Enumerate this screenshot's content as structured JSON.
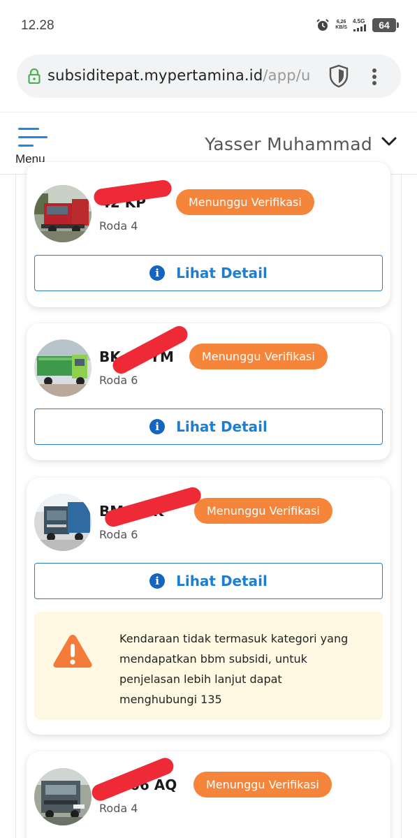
{
  "status_bar": {
    "time": "12.28",
    "net_speed_value": "6,26",
    "net_speed_unit": "KB/S",
    "network_type": "4.5G",
    "battery_level": "64"
  },
  "browser": {
    "url_host": "subsiditepat.mypertamina.id",
    "url_path": "/app/u"
  },
  "header": {
    "menu_label": "Menu",
    "user_name": "Yasser Muhammad"
  },
  "vehicles": [
    {
      "plate_visible": "42 KP",
      "status": "Menunggu Verifikasi",
      "wheels": "Roda 4",
      "detail_label": "Lihat Detail"
    },
    {
      "plate_visible": "BK   1 YM",
      "status": "Menunggu Verifikasi",
      "wheels": "Roda 6",
      "detail_label": "Lihat Detail"
    },
    {
      "plate_visible": "BM 8   K",
      "status": "Menunggu Verifikasi",
      "wheels": "Roda 6",
      "detail_label": "Lihat Detail",
      "warning": "Kendaraan tidak termasuk kategori yang mendapatkan bbm subsidi, untuk penjelasan lebih lanjut dapat menghubungi 135"
    },
    {
      "plate_visible": "066 AQ",
      "status": "Menunggu Verifikasi",
      "wheels": "Roda 4"
    }
  ],
  "colors": {
    "accent_blue": "#1e7ed2",
    "badge_orange": "#f4853a",
    "redaction_red": "#ee2a36",
    "warning_bg": "#fff9e3"
  }
}
